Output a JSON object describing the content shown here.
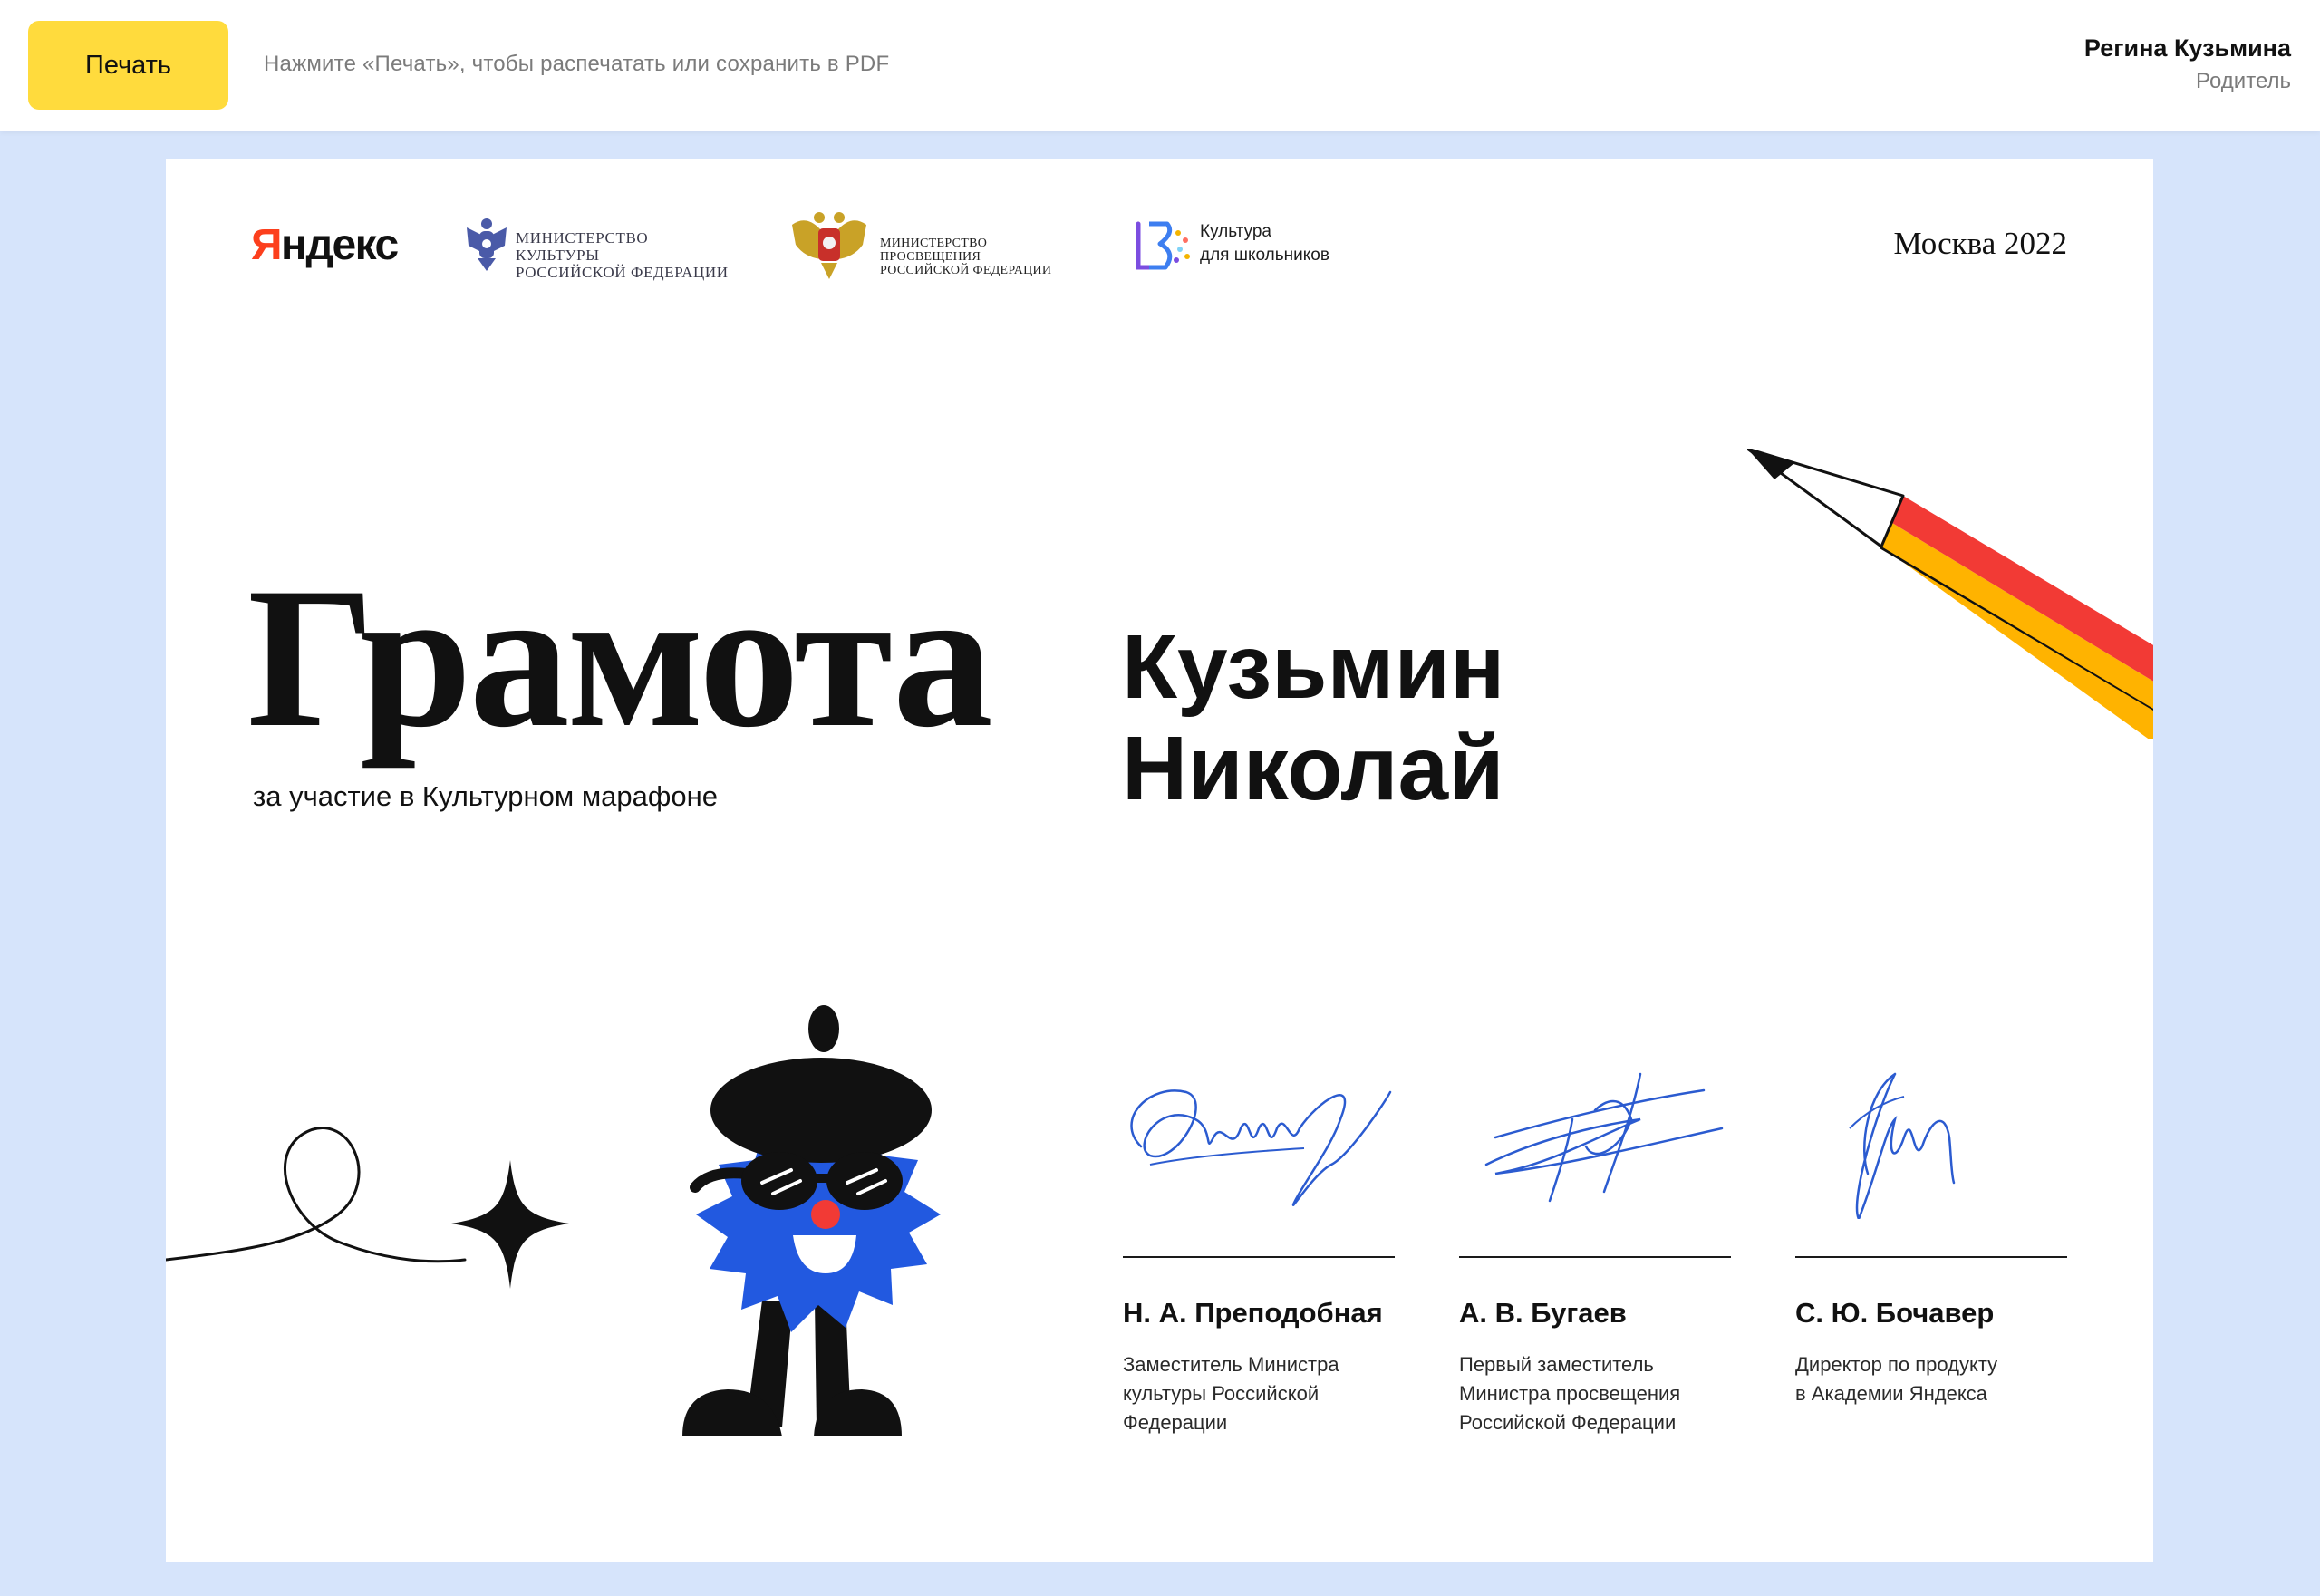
{
  "topbar": {
    "print_label": "Печать",
    "hint": "Нажмите «Печать», чтобы распечатать или сохранить в PDF",
    "user_name": "Регина Кузьмина",
    "user_role": "Родитель"
  },
  "certificate": {
    "logos": {
      "yandex_first": "Я",
      "yandex_rest": "ндекс",
      "ministry_culture_line1": "МИНИСТЕРСТВО КУЛЬТУРЫ",
      "ministry_culture_line2": "РОССИЙСКОЙ ФЕДЕРАЦИИ",
      "ministry_education_line1": "МИНИСТЕРСТВО ПРОСВЕЩЕНИЯ",
      "ministry_education_line2": "РОССИЙСКОЙ ФЕДЕРАЦИИ",
      "kdsh_line1": "Культура",
      "kdsh_line2": "для школьников"
    },
    "city_year": "Москва 2022",
    "title": "Грамота",
    "subtitle": "за участие в Культурном марафоне",
    "recipient": {
      "last_name": "Кузьмин",
      "first_name": "Николай"
    },
    "signers": [
      {
        "name": "Н. А. Преподобная",
        "role_lines": [
          "Заместитель Министра",
          "культуры Российской",
          "Федерации"
        ]
      },
      {
        "name": "А. В. Бугаев",
        "role_lines": [
          "Первый заместитель",
          "Министра просвещения",
          "Российской Федерации"
        ]
      },
      {
        "name": "С. Ю. Бочавер",
        "role_lines": [
          "Директор по продукту",
          "в Академии Яндекса"
        ]
      }
    ]
  },
  "colors": {
    "page_background": "#d6e4fb",
    "print_button": "#ffdb3d",
    "yandex_red": "#fc3f1d",
    "mascot_blue": "#2259e0",
    "signature_ink": "#2b5bd0",
    "pencil_red": "#f23a35",
    "pencil_yellow": "#ffb300"
  },
  "icons": {
    "ministry_culture": "eagle-emblem-icon",
    "ministry_education": "eagle-coat-of-arms-icon",
    "kdsh": "kdsh-logo-icon",
    "decor_pencil": "pencil-icon",
    "decor_star": "sparkle-star-icon",
    "mascot": "beret-mascot-icon"
  }
}
